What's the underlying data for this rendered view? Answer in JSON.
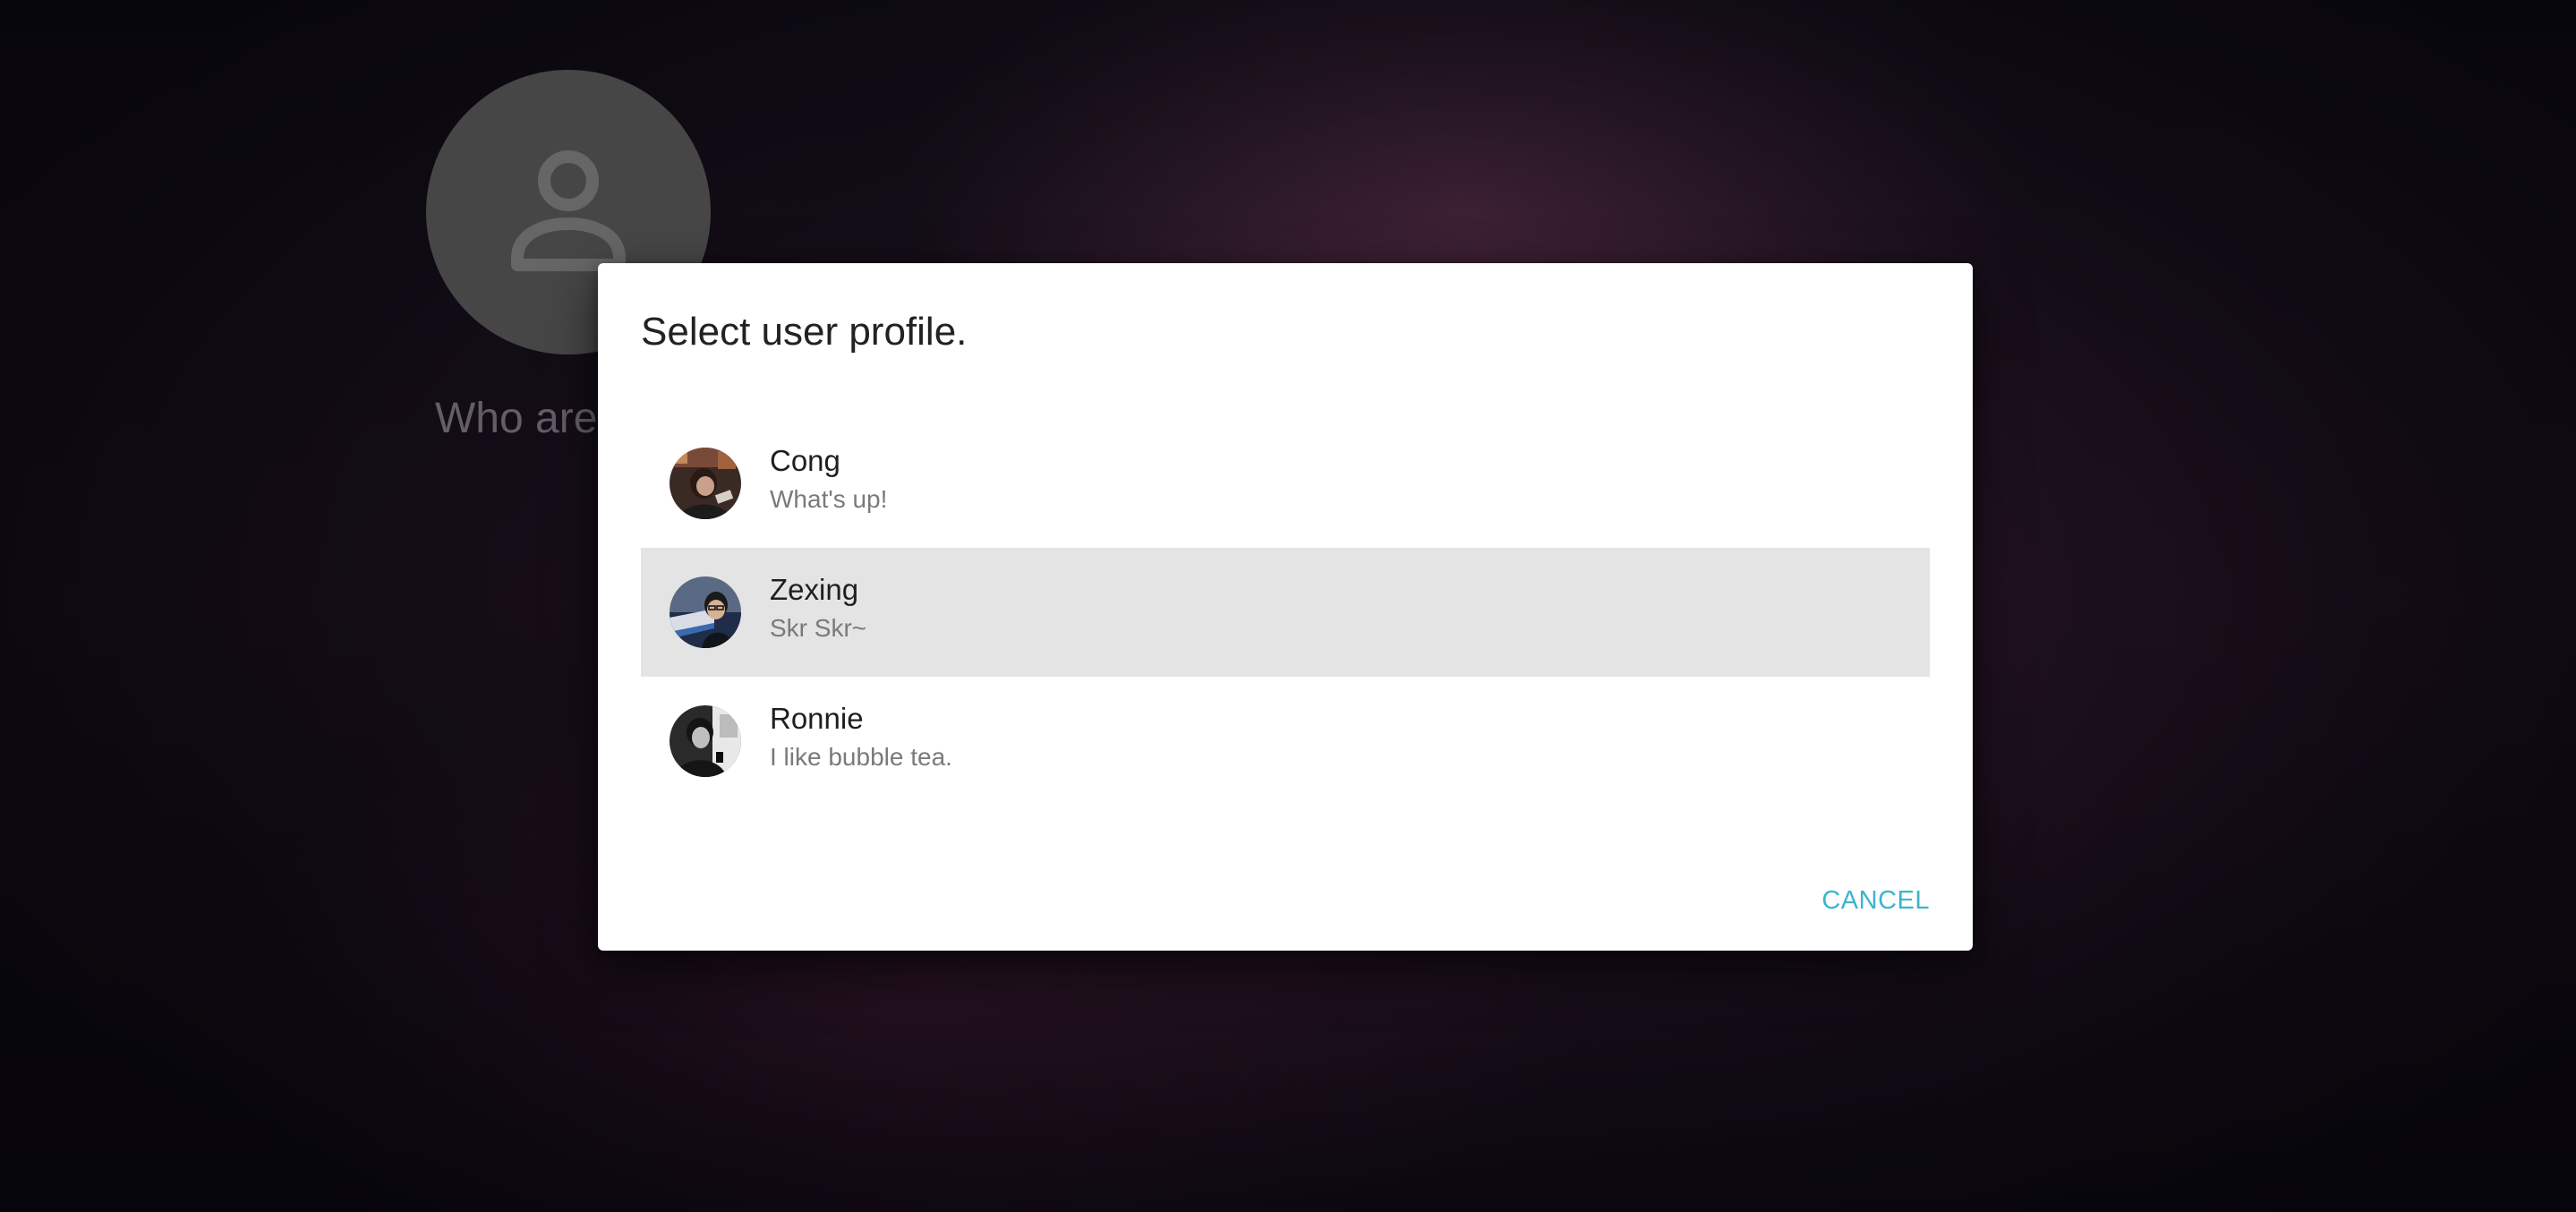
{
  "background": {
    "avatar_icon": "person-icon",
    "question_text": "Who are"
  },
  "dialog": {
    "title": "Select user profile.",
    "profiles": [
      {
        "name": "Cong",
        "status": "What's up!",
        "avatar_icon": "user-photo",
        "selected": false
      },
      {
        "name": "Zexing",
        "status": "Skr Skr~",
        "avatar_icon": "user-photo",
        "selected": true
      },
      {
        "name": "Ronnie",
        "status": "I like bubble tea.",
        "avatar_icon": "user-photo",
        "selected": false
      }
    ],
    "cancel_label": "CANCEL"
  },
  "colors": {
    "accent": "#3bb5cf",
    "selected_row": "#e4e4e4",
    "dialog_background": "#ffffff",
    "placeholder_avatar": "#626262"
  }
}
